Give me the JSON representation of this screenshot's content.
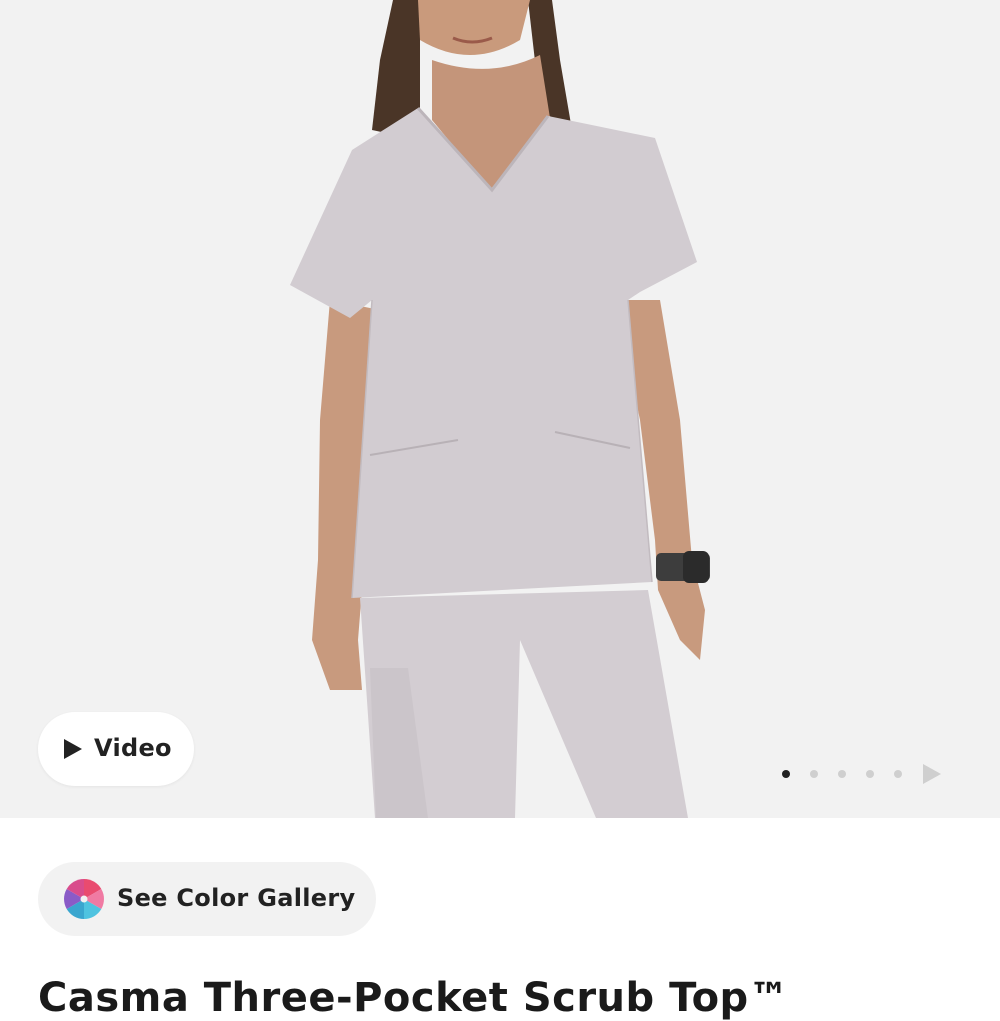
{
  "hero": {
    "video_label": "Video",
    "carousel": {
      "slide_count": 5,
      "active_index": 0
    }
  },
  "gallery": {
    "label": "See Color Gallery"
  },
  "product": {
    "title": "Casma Three-Pocket Scrub Top™"
  },
  "colors": {
    "background": "#f2f2f2",
    "scrub": "#cfc9cd",
    "text": "#222222",
    "dot_inactive": "#cfcfcf"
  }
}
